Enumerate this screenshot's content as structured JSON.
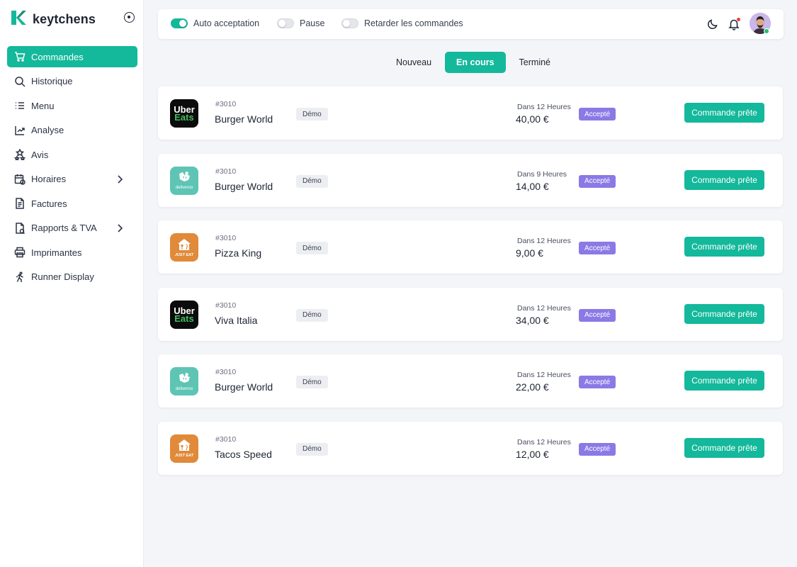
{
  "brand": {
    "name": "keytchens"
  },
  "sidebar": {
    "items": [
      {
        "label": "Commandes",
        "icon": "cart-icon",
        "active": true
      },
      {
        "label": "Historique",
        "icon": "search-icon"
      },
      {
        "label": "Menu",
        "icon": "list-icon"
      },
      {
        "label": "Analyse",
        "icon": "analytics-icon"
      },
      {
        "label": "Avis",
        "icon": "stars-icon"
      },
      {
        "label": "Horaires",
        "icon": "calendar-clock-icon",
        "chevron": true
      },
      {
        "label": "Factures",
        "icon": "document-icon"
      },
      {
        "label": "Rapports & TVA",
        "icon": "report-icon",
        "chevron": true
      },
      {
        "label": "Imprimantes",
        "icon": "printer-icon"
      },
      {
        "label": "Runner Display",
        "icon": "runner-icon"
      }
    ]
  },
  "topbar": {
    "toggles": [
      {
        "label": "Auto acceptation",
        "on": true
      },
      {
        "label": "Pause",
        "on": false
      },
      {
        "label": "Retarder les commandes",
        "on": false
      }
    ]
  },
  "tabs": [
    {
      "label": "Nouveau"
    },
    {
      "label": "En cours",
      "active": true
    },
    {
      "label": "Terminé"
    }
  ],
  "orders": [
    {
      "platform": "uber-eats",
      "logo_l1": "Uber",
      "logo_l2": "Eats",
      "number": "#3010",
      "name": "Burger World",
      "tag": "Démo",
      "eta": "Dans 12 Heures",
      "price": "40,00 €",
      "status": "Accepté",
      "action": "Commande prête"
    },
    {
      "platform": "deliveroo",
      "logo_text": "deliveroo",
      "number": "#3010",
      "name": "Burger World",
      "tag": "Démo",
      "eta": "Dans 9 Heures",
      "price": "14,00 €",
      "status": "Accepté",
      "action": "Commande prête"
    },
    {
      "platform": "just-eat",
      "logo_text": "JUST EAT",
      "number": "#3010",
      "name": "Pizza King",
      "tag": "Démo",
      "eta": "Dans 12 Heures",
      "price": "9,00 €",
      "status": "Accepté",
      "action": "Commande prête"
    },
    {
      "platform": "uber-eats",
      "logo_l1": "Uber",
      "logo_l2": "Eats",
      "number": "#3010",
      "name": "Viva Italia",
      "tag": "Démo",
      "eta": "Dans 12 Heures",
      "price": "34,00 €",
      "status": "Accepté",
      "action": "Commande prête"
    },
    {
      "platform": "deliveroo",
      "logo_text": "deliveroo",
      "number": "#3010",
      "name": "Burger World",
      "tag": "Démo",
      "eta": "Dans 12 Heures",
      "price": "22,00 €",
      "status": "Accepté",
      "action": "Commande prête"
    },
    {
      "platform": "just-eat",
      "logo_text": "JUST EAT",
      "number": "#3010",
      "name": "Tacos Speed",
      "tag": "Démo",
      "eta": "Dans 12 Heures",
      "price": "12,00 €",
      "status": "Accepté",
      "action": "Commande prête"
    }
  ],
  "colors": {
    "accent": "#14b89b",
    "status_accepted": "#8b79e6",
    "uber_eats": "#0b0b0b",
    "deliveroo": "#5ec4b4",
    "just_eat": "#e08a3a"
  }
}
